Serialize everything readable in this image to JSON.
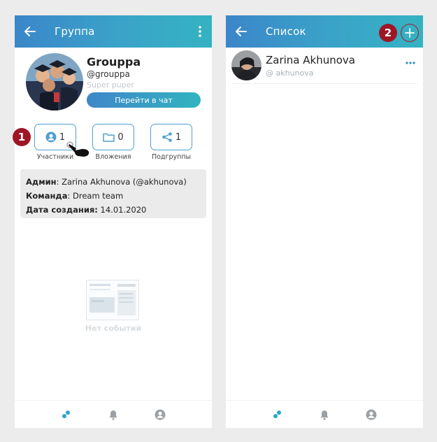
{
  "left_screen": {
    "appbar": {
      "title": "Группа"
    },
    "group": {
      "name": "Grouppa",
      "handle": "@grouppa",
      "description": "Super puper",
      "chat_button_label": "Перейти в чат"
    },
    "stats": [
      {
        "count": "1",
        "label": "Участники",
        "icon": "user-circle-icon"
      },
      {
        "count": "0",
        "label": "Вложения",
        "icon": "folder-icon"
      },
      {
        "count": "1",
        "label": "Подгруппы",
        "icon": "share-icon"
      }
    ],
    "info": {
      "admin_label": "Админ",
      "admin_value": ": Zarina Akhunova (@akhunova)",
      "team_label": "Команда",
      "team_value": ": Dream team",
      "created_label": "Дата создания:",
      "created_value": " 14.01.2020"
    },
    "empty_state_text": "Нет событий",
    "step_badge": "1"
  },
  "right_screen": {
    "appbar": {
      "title": "Список"
    },
    "contacts": [
      {
        "name": "Zarina Akhunova",
        "handle": "@ akhunova"
      }
    ],
    "step_badge": "2"
  },
  "colors": {
    "appbar_start": "#3b86c9",
    "appbar_end": "#35b2c2",
    "accent": "#4f9fd2",
    "badge": "#9e1625",
    "nav_active": "#2aa7c7",
    "nav_inactive": "#9aa0a5"
  }
}
